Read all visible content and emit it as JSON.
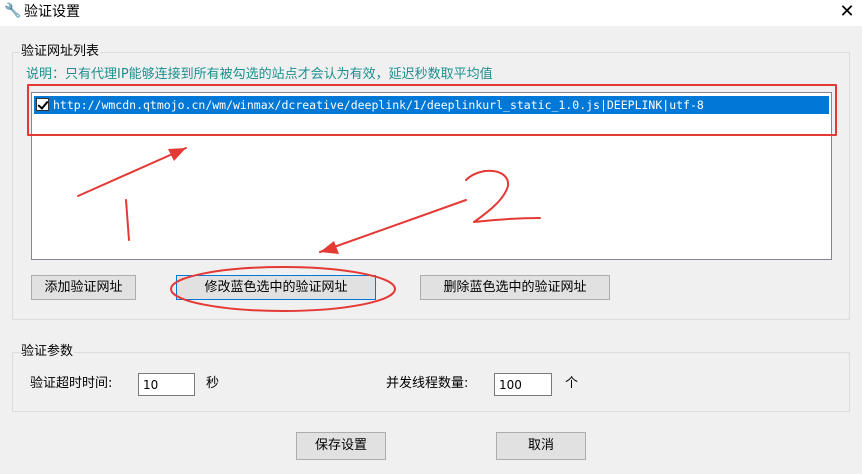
{
  "window": {
    "title": "验证设置",
    "close_glyph": "✕",
    "icon": "config-app-icon"
  },
  "url_group": {
    "label": "验证网址列表",
    "note": "说明：只有代理IP能够连接到所有被勾选的站点才会认为有效，延迟秒数取平均值",
    "items": [
      {
        "checked": true,
        "text": "http://wmcdn.qtmojo.cn/wm/winmax/dcreative/deeplink/1/deeplinkurl_static_1.0.js|DEEPLINK|utf-8"
      }
    ],
    "buttons": {
      "add": "添加验证网址",
      "edit": "修改蓝色选中的验证网址",
      "delete": "删除蓝色选中的验证网址"
    }
  },
  "param_group": {
    "label": "验证参数",
    "timeout_label": "验证超时时间:",
    "timeout_value": "10",
    "timeout_unit": "秒",
    "threads_label": "并发线程数量:",
    "threads_value": "100",
    "threads_unit": "个"
  },
  "footer": {
    "save": "保存设置",
    "cancel": "取消"
  },
  "annotations": {
    "label_1": "1",
    "label_2": "2",
    "color": "#e53935"
  }
}
